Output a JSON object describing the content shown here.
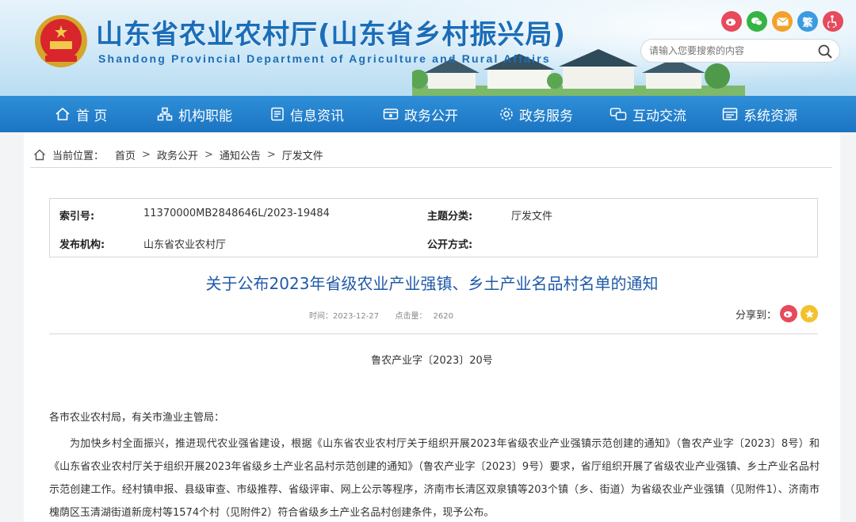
{
  "header": {
    "title": "山东省农业农村厅(山东省乡村振兴局)",
    "subtitle": "Shandong Provincial Department of Agriculture and Rural Affairs",
    "social": [
      {
        "icon": "weibo-icon",
        "color": "#e64a5c"
      },
      {
        "icon": "wechat-icon",
        "color": "#35b443"
      },
      {
        "icon": "mail-icon",
        "color": "#f4a12b"
      },
      {
        "icon": "traditional-icon",
        "label": "繁",
        "color": "#3c9be0"
      },
      {
        "icon": "accessibility-icon",
        "color": "#e64a5c"
      }
    ],
    "search_placeholder": "请输入您要搜索的内容"
  },
  "nav": {
    "items": [
      {
        "label": "首 页",
        "icon": "home-icon"
      },
      {
        "label": "机构职能",
        "icon": "org-icon"
      },
      {
        "label": "信息资讯",
        "icon": "doc-icon"
      },
      {
        "label": "政务公开",
        "icon": "open-icon"
      },
      {
        "label": "政务服务",
        "icon": "service-icon"
      },
      {
        "label": "互动交流",
        "icon": "chat-icon"
      },
      {
        "label": "系统资源",
        "icon": "system-icon"
      }
    ]
  },
  "breadcrumb": {
    "prefix": "当前位置：",
    "items": [
      "首页",
      "政务公开",
      "通知公告",
      "厅发文件"
    ]
  },
  "meta": {
    "index_label": "索引号:",
    "index_value": "11370000MB2848646L/2023-19484",
    "topic_label": "主题分类:",
    "topic_value": "厅发文件",
    "publisher_label": "发布机构:",
    "publisher_value": "山东省农业农村厅",
    "public_label": "公开方式:",
    "public_value": ""
  },
  "article": {
    "title": "关于公布2023年省级农业产业强镇、乡土产业名品村名单的通知",
    "time_label": "时间：",
    "time_value": "2023-12-27",
    "hits_label": "点击量：",
    "hits_value": "2620",
    "share_label": "分享到：",
    "doc_number": "鲁农产业字〔2023〕20号",
    "salutation": "各市农业农村局，有关市渔业主管局：",
    "body": "为加快乡村全面振兴，推进现代农业强省建设，根据《山东省农业农村厅关于组织开展2023年省级农业产业强镇示范创建的通知》（鲁农产业字〔2023〕8号）和《山东省农业农村厅关于组织开展2023年省级乡土产业名品村示范创建的通知》（鲁农产业字〔2023〕9号）要求，省厅组织开展了省级农业产业强镇、乡土产业名品村示范创建工作。经村镇申报、县级审查、市级推荐、省级评审、网上公示等程序，济南市长清区双泉镇等203个镇（乡、街道）为省级农业产业强镇（见附件1）、济南市槐荫区玉清湖街道新庞村等1574个村（见附件2）符合省级乡土产业名品村创建条件，现予公布。"
  }
}
